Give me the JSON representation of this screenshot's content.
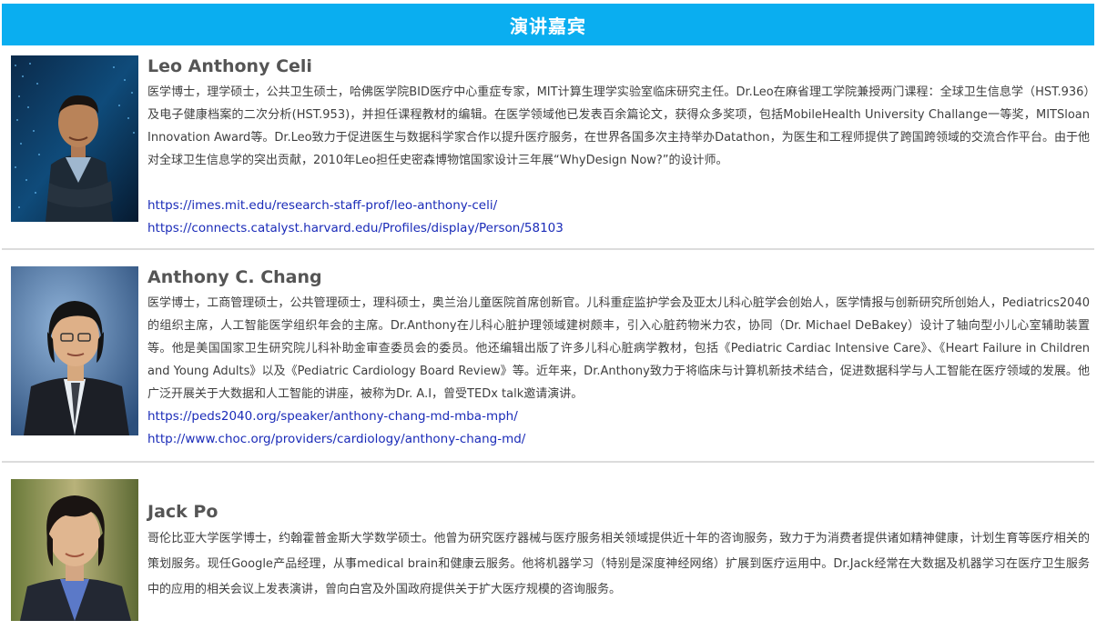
{
  "header": {
    "title": "演讲嘉宾"
  },
  "speakers": [
    {
      "name": "Leo Anthony Celi",
      "bio": "医学博士，理学硕士，公共卫生硕士，哈佛医学院BID医疗中心重症专家，MIT计算生理学实验室临床研究主任。Dr.Leo在麻省理工学院兼授两门课程：全球卫生信息学（HST.936）及电子健康档案的二次分析(HST.953)，并担任课程教材的编辑。在医学领域他已发表百余篇论文，获得众多奖项，包括MobileHealth University Challange一等奖，MITSloan Innovation Award等。Dr.Leo致力于促进医生与数据科学家合作以提升医疗服务，在世界各国多次主持举办Datathon，为医生和工程师提供了跨国跨领域的交流合作平台。由于他对全球卫生信息学的突出贡献，2010年Leo担任史密森博物馆国家设计三年展“WhyDesign Now?”的设计师。",
      "links": [
        "https://imes.mit.edu/research-staff-prof/leo-anthony-celi/",
        "https://connects.catalyst.harvard.edu/Profiles/display/Person/58103"
      ]
    },
    {
      "name": "Anthony C. Chang",
      "bio": "医学博士，工商管理硕士，公共管理硕士，理科硕士，奥兰治儿童医院首席创新官。儿科重症监护学会及亚太儿科心脏学会创始人，医学情报与创新研究所创始人，Pediatrics2040的组织主席，人工智能医学组织年会的主席。Dr.Anthony在儿科心脏护理领域建树颇丰，引入心脏药物米力农，协同（Dr. Michael DeBakey）设计了轴向型小儿心室辅助装置等。他是美国国家卫生研究院儿科补助金审查委员会的委员。他还编辑出版了许多儿科心脏病学教材，包括《Pediatric Cardiac Intensive Care》、《Heart Failure in Children and Young Adults》以及《Pediatric Cardiology Board Review》等。近年来，Dr.Anthony致力于将临床与计算机新技术结合，促进数据科学与人工智能在医疗领域的发展。他广泛开展关于大数据和人工智能的讲座，被称为Dr. A.I，曾受TEDx talk邀请演讲。",
      "links": [
        "https://peds2040.org/speaker/anthony-chang-md-mba-mph/",
        "http://www.choc.org/providers/cardiology/anthony-chang-md/"
      ]
    },
    {
      "name": "Jack Po",
      "bio": "哥伦比亚大学医学博士，约翰霍普金斯大学数学硕士。他曾为研究医疗器械与医疗服务相关领域提供近十年的咨询服务，致力于为消费者提供诸如精神健康，计划生育等医疗相关的策划服务。现任Google产品经理，从事medical brain和健康云服务。他将机器学习（特别是深度神经网络）扩展到医疗运用中。Dr.Jack经常在大数据及机器学习在医疗卫生服务中的应用的相关会议上发表演讲，曾向白宫及外国政府提供关于扩大医疗规模的咨询服务。",
      "links": []
    }
  ],
  "colors": {
    "header_bg": "#0aaef0",
    "link": "#1a2bb8",
    "divider": "#dcdcdc"
  }
}
